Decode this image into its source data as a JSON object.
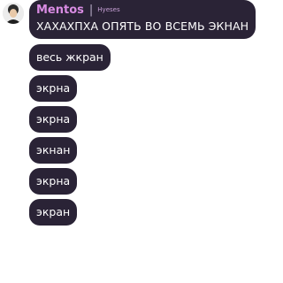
{
  "avatar": {
    "icon": "avatar-photo-icon"
  },
  "first_message": {
    "author": "Mentos",
    "separator": "|",
    "tag": "Hyeses",
    "text": "ХАХАХПХА ОПЯТЬ ВО ВСЕМЬ ЭКНАН"
  },
  "messages": [
    {
      "text": "весь жкран"
    },
    {
      "text": "экрна"
    },
    {
      "text": "экрна"
    },
    {
      "text": "экнан"
    },
    {
      "text": "экрна"
    },
    {
      "text": "экран"
    }
  ],
  "colors": {
    "bubble": "#2a2336",
    "author": "#d98ce3",
    "text": "#ffffff"
  }
}
